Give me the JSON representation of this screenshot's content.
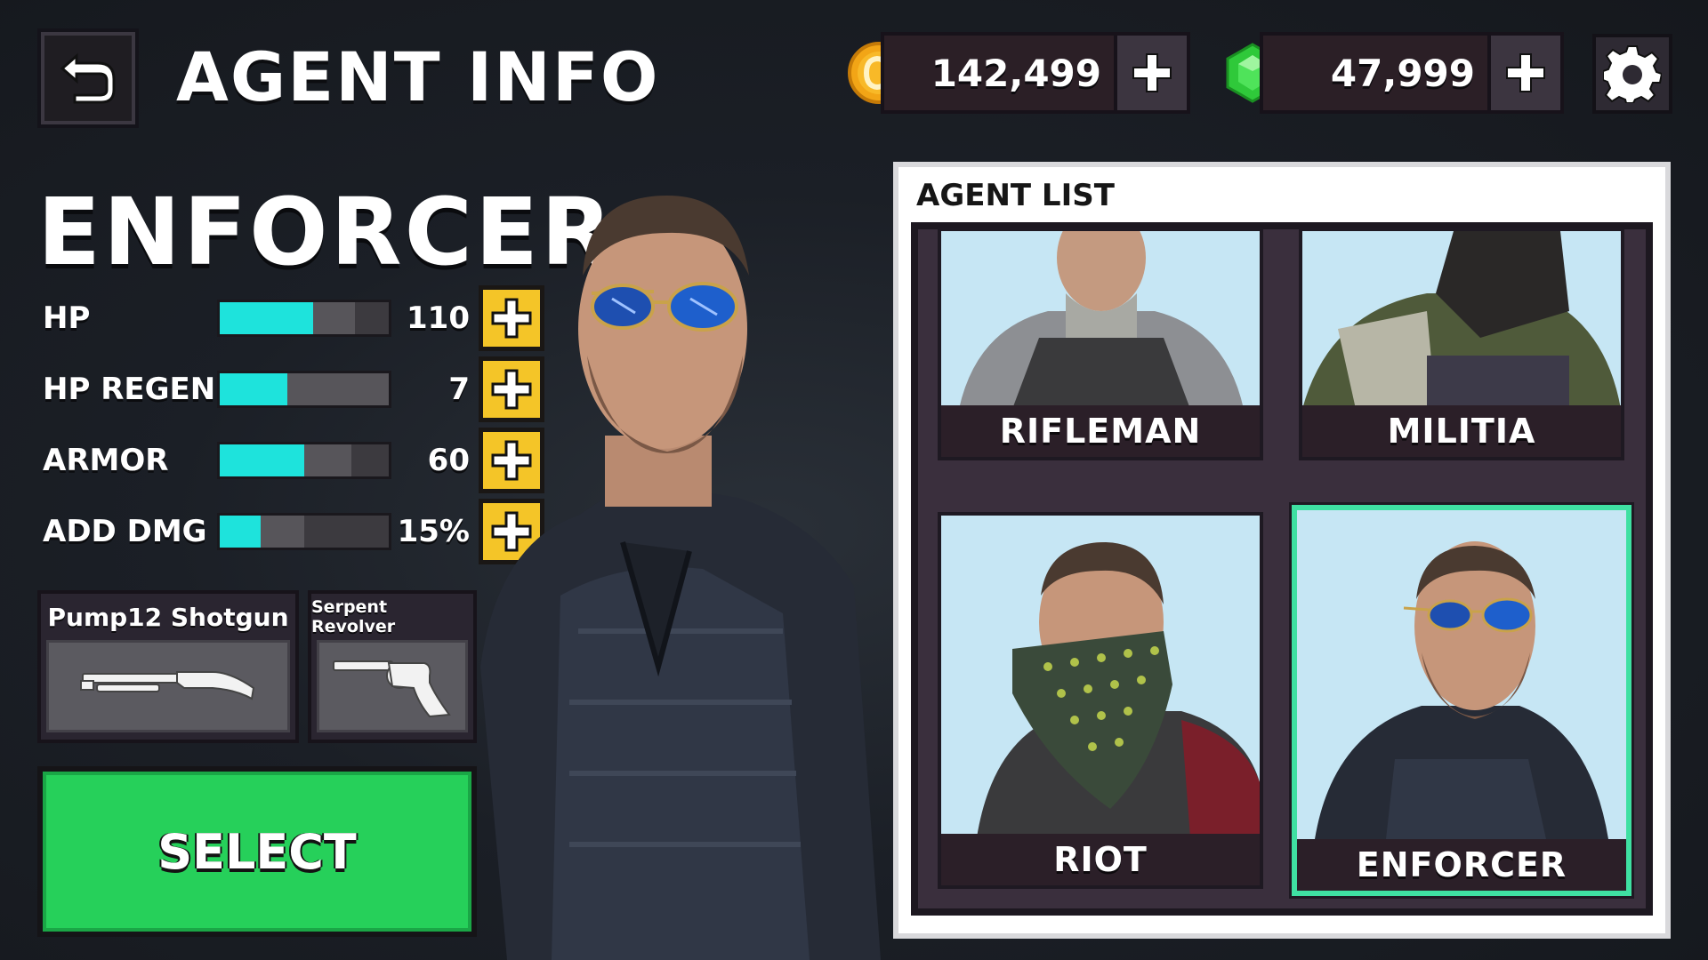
{
  "header": {
    "back_icon": "back-arrow-icon",
    "title": "AGENT INFO",
    "coins": {
      "icon": "coin-icon",
      "amount": "142,499",
      "add_icon": "plus-icon"
    },
    "gems": {
      "icon": "gem-icon",
      "amount": "47,999",
      "add_icon": "plus-icon"
    },
    "settings_icon": "gear-icon"
  },
  "agent": {
    "name": "ENFORCER",
    "stats": [
      {
        "label": "HP",
        "value": "110",
        "level": 0.55,
        "max_level": 0.8
      },
      {
        "label": "HP REGEN",
        "value": "7",
        "level": 0.4,
        "max_level": 1.0
      },
      {
        "label": "ARMOR",
        "value": "60",
        "level": 0.5,
        "max_level": 0.78
      },
      {
        "label": "ADD DMG",
        "value": "15%",
        "level": 0.24,
        "max_level": 0.5
      }
    ],
    "weapons": {
      "primary": {
        "name": "Pump12 Shotgun",
        "icon": "shotgun-icon"
      },
      "secondary": {
        "name": "Serpent Revolver",
        "icon": "revolver-icon"
      }
    },
    "select_label": "SELECT"
  },
  "agent_list": {
    "title": "AGENT LIST",
    "agents": [
      {
        "name": "RIFLEMAN",
        "selected": false
      },
      {
        "name": "MILITIA",
        "selected": false
      },
      {
        "name": "RIOT",
        "selected": false
      },
      {
        "name": "ENFORCER",
        "selected": true
      }
    ]
  },
  "colors": {
    "stat_fill": "#1ee3dc",
    "upgrade_button": "#f4c528",
    "select_button": "#26d05a",
    "selected_card_outline": "#3fe0a2",
    "portrait_background": "#c6e6f4"
  }
}
